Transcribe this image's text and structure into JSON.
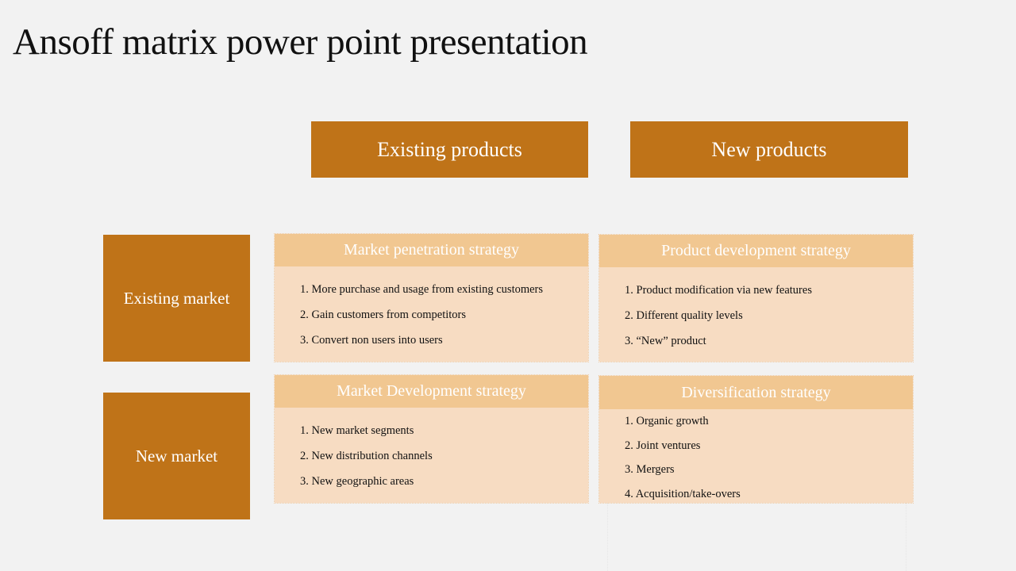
{
  "slide": {
    "title": "Ansoff matrix power point presentation"
  },
  "columns": [
    "Existing products",
    "New products"
  ],
  "rows": [
    "Existing market",
    "New market"
  ],
  "colors": {
    "header_fill": "#bf7318",
    "cell_header_fill": "#f1c791",
    "cell_body_fill": "#f7dcc2",
    "background": "#f2f2f2"
  },
  "cells": {
    "market_penetration": {
      "title": "Market penetration strategy",
      "items": [
        "1. More purchase and usage from existing customers",
        "2. Gain customers from competitors",
        "3. Convert non users into users"
      ]
    },
    "product_development": {
      "title": "Product development strategy",
      "items": [
        "1. Product modification via new features",
        "2. Different quality levels",
        "3. “New” product"
      ]
    },
    "market_development": {
      "title": "Market Development strategy",
      "items": [
        "1. New market segments",
        "2. New distribution channels",
        "3. New geographic areas"
      ]
    },
    "diversification": {
      "title": "Diversification strategy",
      "items": [
        "1. Organic growth",
        "2. Joint ventures",
        "3. Mergers",
        "4. Acquisition/take-overs"
      ]
    }
  }
}
